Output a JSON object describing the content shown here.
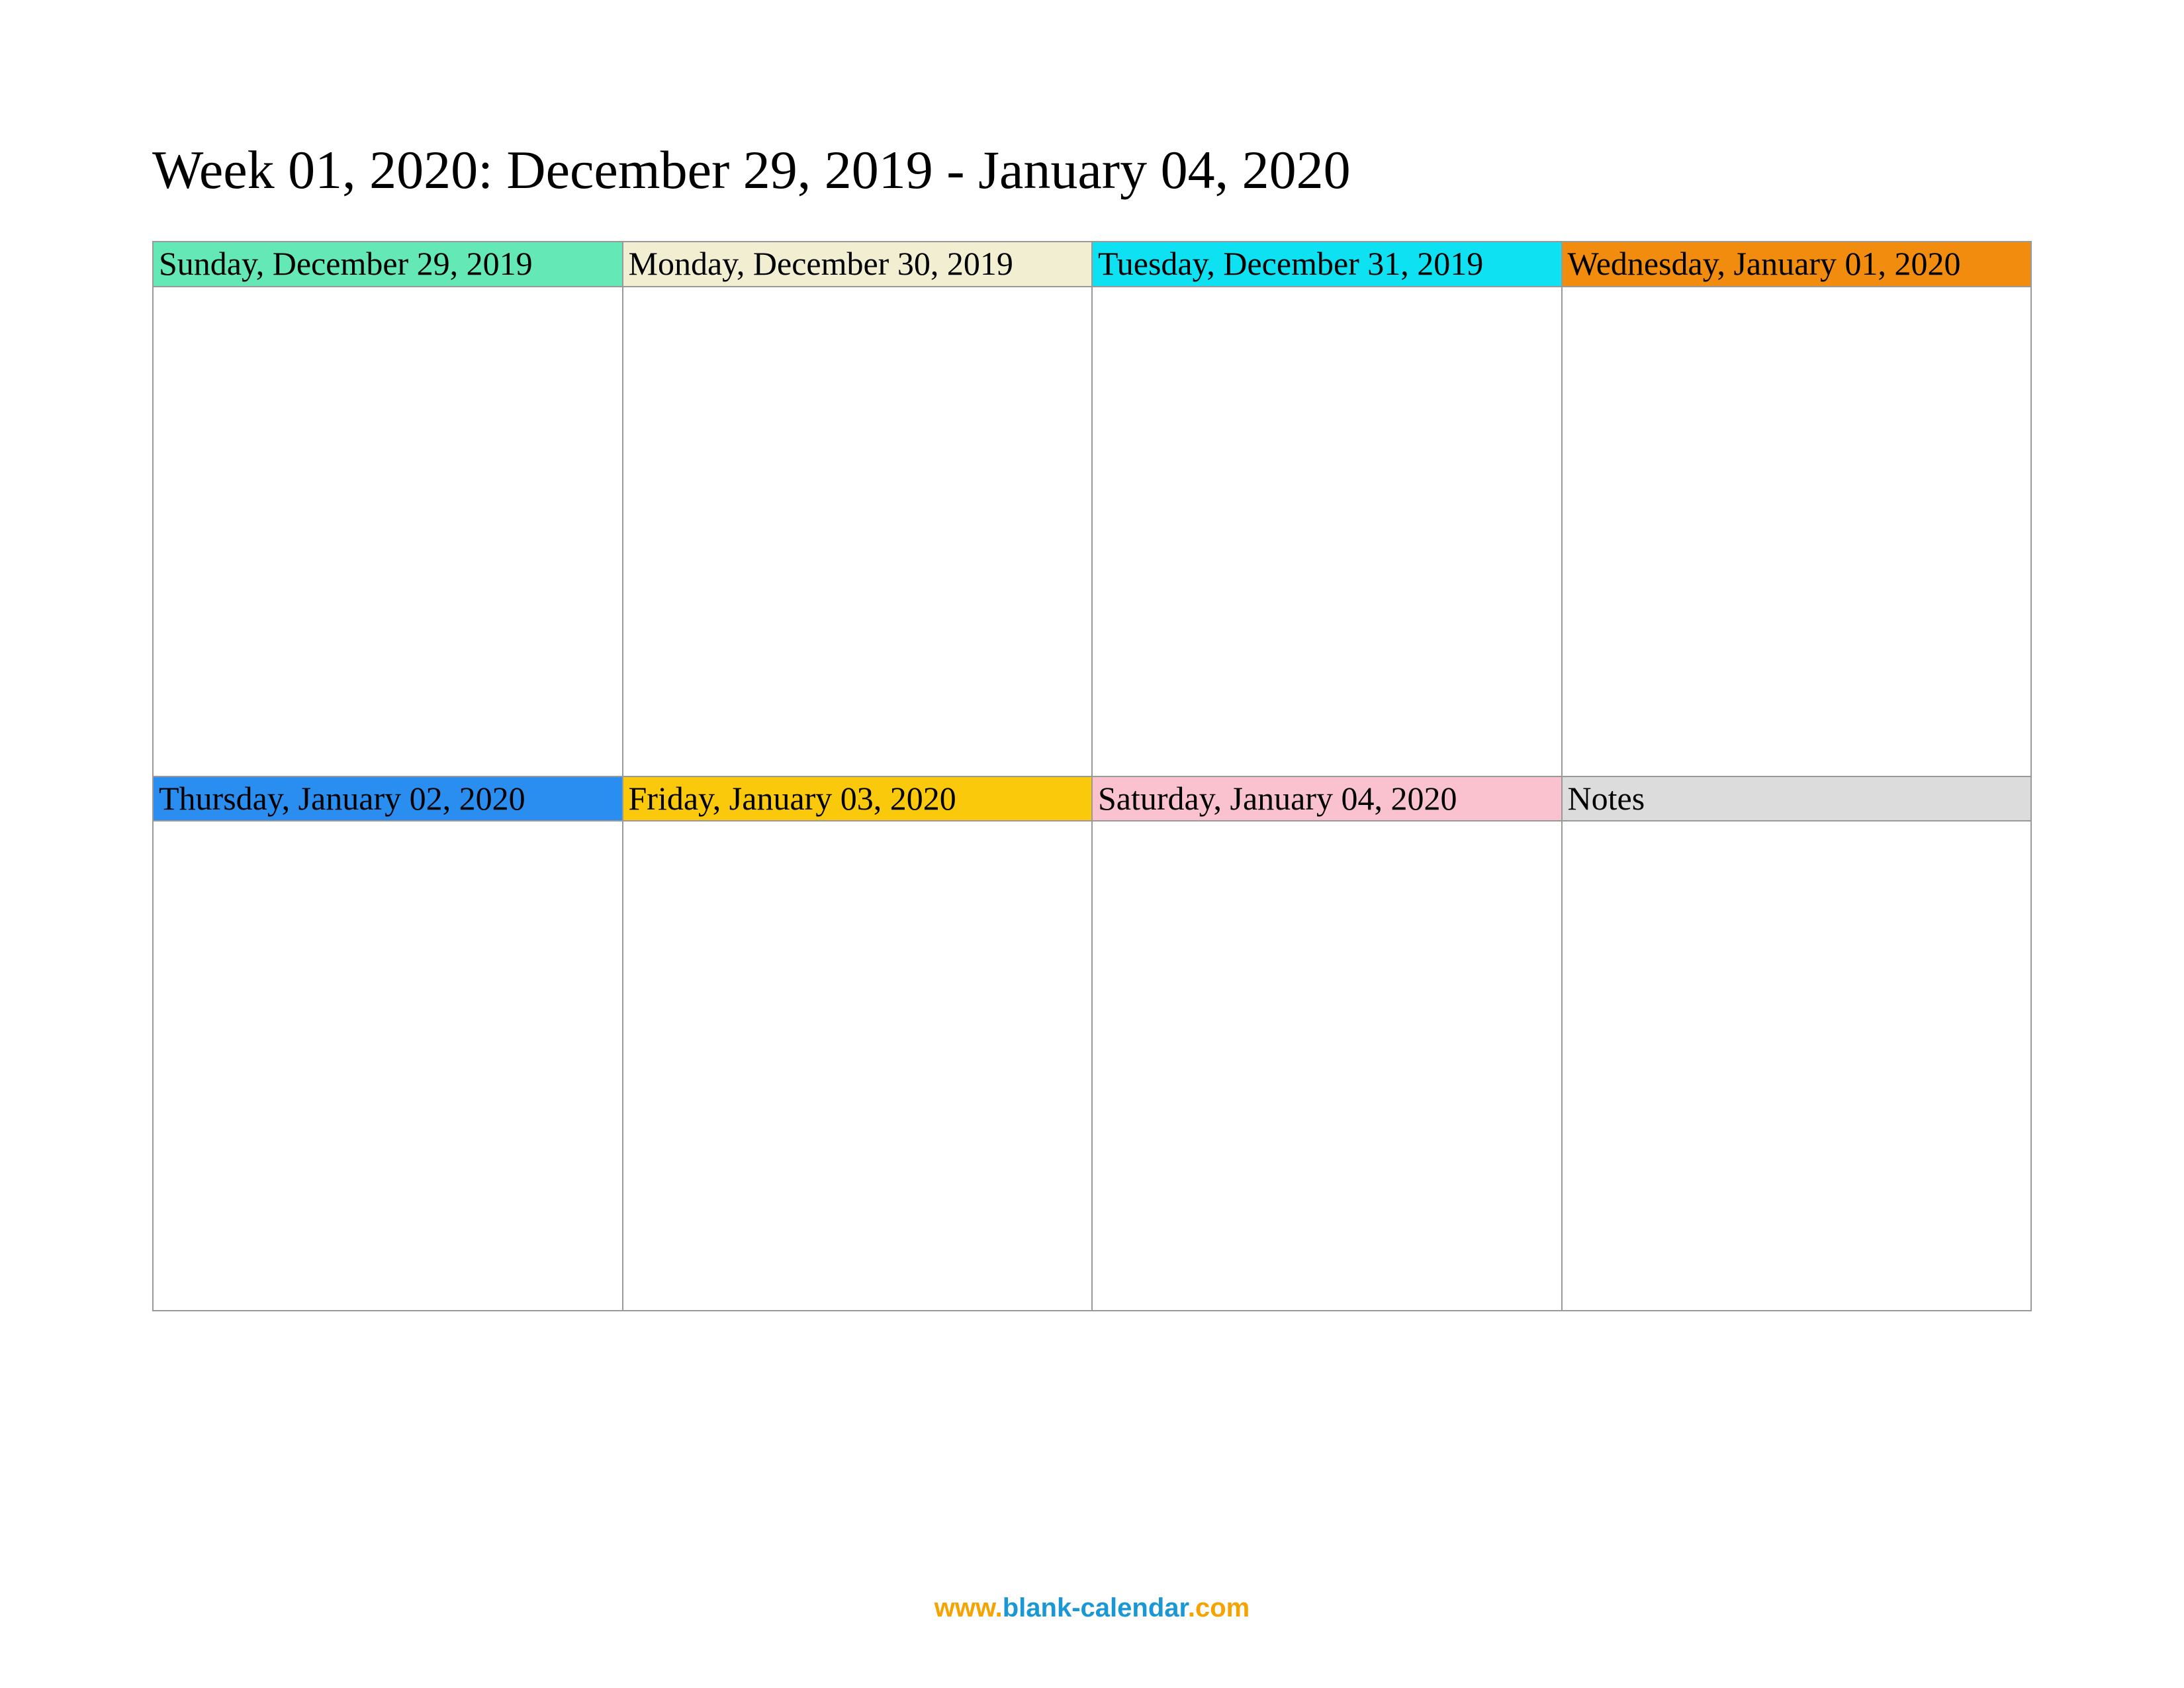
{
  "title": "Week 01, 2020: December 29, 2019 - January 04, 2020",
  "days": [
    {
      "label": "Sunday, December 29, 2019",
      "bg": "#63e8b6"
    },
    {
      "label": "Monday, December 30, 2019",
      "bg": "#f2eed1"
    },
    {
      "label": "Tuesday, December 31, 2019",
      "bg": "#0ee1f2"
    },
    {
      "label": "Wednesday, January 01, 2020",
      "bg": "#f28c0f"
    },
    {
      "label": "Thursday, January 02, 2020",
      "bg": "#2a8ef0"
    },
    {
      "label": "Friday, January 03, 2020",
      "bg": "#fbc90b"
    },
    {
      "label": "Saturday, January 04, 2020",
      "bg": "#fac2cf"
    },
    {
      "label": "Notes",
      "bg": "#dcdcdc"
    }
  ],
  "footer": {
    "p1": "www.",
    "p2": "blank-calendar",
    "p3": ".com"
  }
}
